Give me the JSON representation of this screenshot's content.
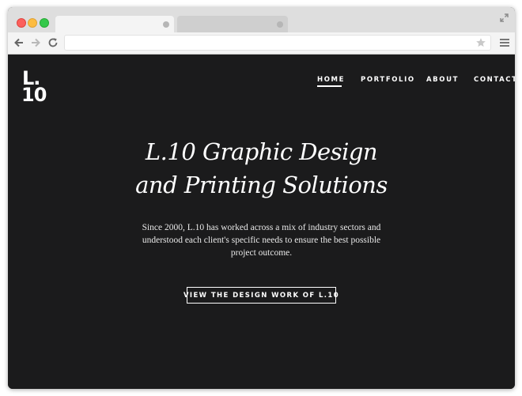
{
  "browser": {
    "tabs": [
      {
        "label": "",
        "active": true
      },
      {
        "label": "",
        "active": false
      }
    ],
    "address_bar": {
      "value": "",
      "placeholder": ""
    }
  },
  "site": {
    "logo": {
      "line1": "L.",
      "line2": "10"
    },
    "nav": [
      {
        "label": "HOME",
        "active": true
      },
      {
        "label": "PORTFOLIO",
        "active": false
      },
      {
        "label": "ABOUT",
        "active": false
      },
      {
        "label": "CONTACT",
        "active": false
      }
    ],
    "hero": {
      "title_line1": "L.10 Graphic Design",
      "title_line2": "and Printing Solutions",
      "description": "Since 2000, L.10 has worked across a mix of industry sectors and understood each client's specific needs to ensure the best possible project outcome.",
      "cta_label": "VIEW THE DESIGN WORK OF L.10"
    }
  },
  "colors": {
    "page_background": "#1b1b1c",
    "text": "#ffffff",
    "chrome": "#dedede",
    "traffic_red": "#fc605c",
    "traffic_yellow": "#fdbc40",
    "traffic_green": "#34c84a"
  },
  "icons": [
    "back-arrow-icon",
    "forward-arrow-icon",
    "reload-icon",
    "star-icon",
    "hamburger-menu-icon",
    "expand-icon"
  ]
}
